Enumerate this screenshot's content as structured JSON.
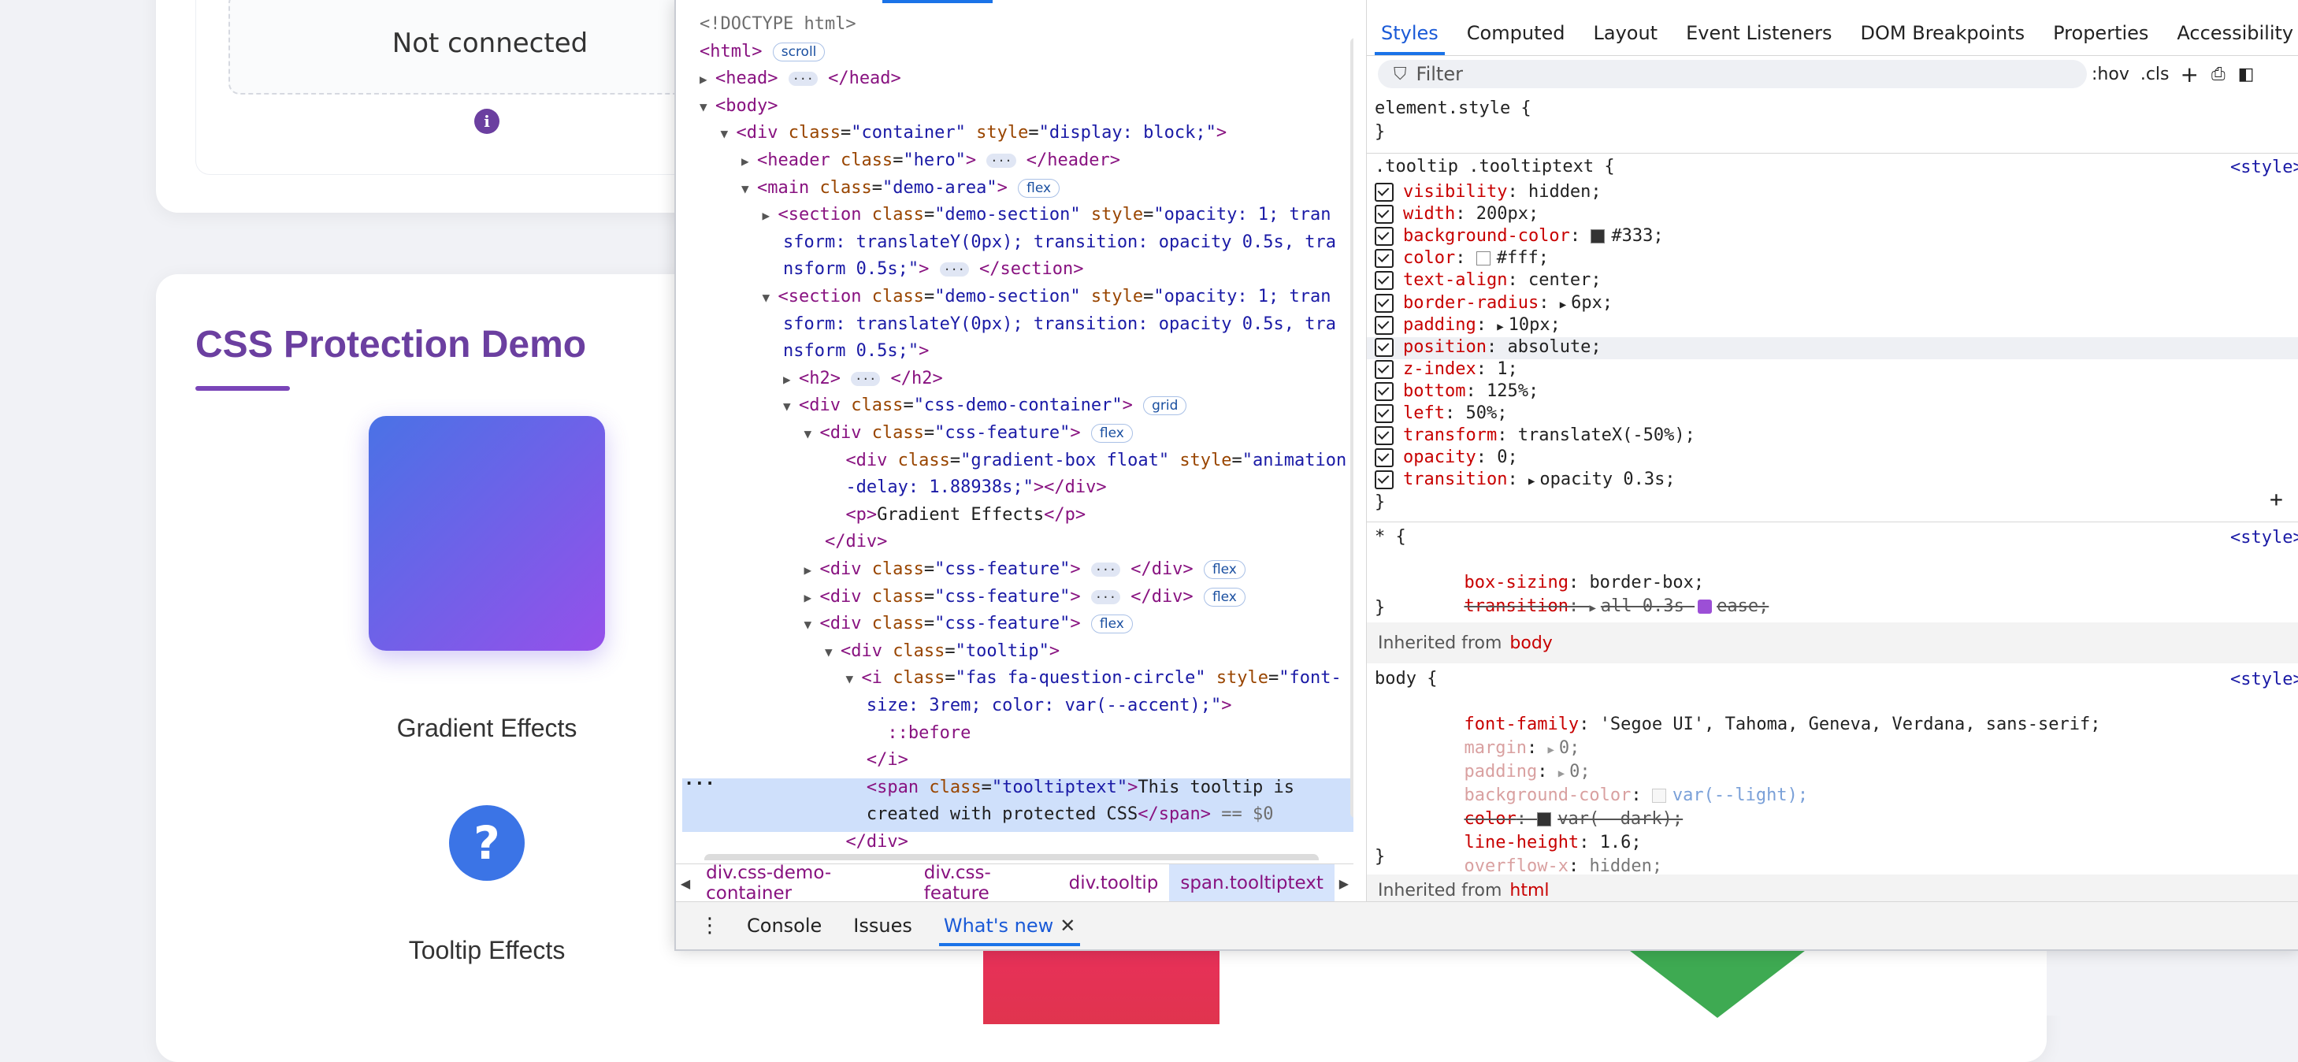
{
  "page": {
    "not_connected": "Not connected",
    "info_icon": "i",
    "demo_title": "CSS Protection Demo",
    "gradient_label": "Gradient Effects",
    "question_glyph": "?",
    "tooltip_label": "Tooltip Effects"
  },
  "devtools": {
    "elements": {
      "lines": [
        {
          "html": "<span class='cm'>&lt;!DOCTYPE html&gt;</span>"
        },
        {
          "html": "<span class='tag'>&lt;html&gt;</span> <span class='pill'>scroll</span>"
        },
        {
          "html": "<span class='tri'>▶</span><span class='tag'>&lt;head&gt;</span> <span class='dots'>···</span> <span class='tag'>&lt;/head&gt;</span>"
        },
        {
          "html": "<span class='tri'>▼</span><span class='tag'>&lt;body&gt;</span>"
        },
        {
          "html": "  <span class='tri'>▼</span><span class='tag'>&lt;div </span><span class='attr'>class</span>=<span class='val'>\"container\"</span> <span class='attr'>style</span>=<span class='val'>\"display: block;\"</span><span class='tag'>&gt;</span>"
        },
        {
          "html": "    <span class='tri'>▶</span><span class='tag'>&lt;header </span><span class='attr'>class</span>=<span class='val'>\"hero\"</span><span class='tag'>&gt;</span> <span class='dots'>···</span> <span class='tag'>&lt;/header&gt;</span>"
        },
        {
          "html": "    <span class='tri'>▼</span><span class='tag'>&lt;main </span><span class='attr'>class</span>=<span class='val'>\"demo-area\"</span><span class='tag'>&gt;</span> <span class='pill'>flex</span>"
        },
        {
          "html": "      <span class='tri'>▶</span><span class='tag'>&lt;section </span><span class='attr'>class</span>=<span class='val'>\"demo-section\"</span> <span class='attr'>style</span>=<span class='val'>\"opacity: 1; tran</span>"
        },
        {
          "html": "        <span class='val'>sform: translateY(0px); transition: opacity 0.5s, tra</span>"
        },
        {
          "html": "        <span class='val'>nsform 0.5s;\"</span><span class='tag'>&gt;</span> <span class='dots'>···</span> <span class='tag'>&lt;/section&gt;</span>"
        },
        {
          "html": "      <span class='tri'>▼</span><span class='tag'>&lt;section </span><span class='attr'>class</span>=<span class='val'>\"demo-section\"</span> <span class='attr'>style</span>=<span class='val'>\"opacity: 1; tran</span>"
        },
        {
          "html": "        <span class='val'>sform: translateY(0px); transition: opacity 0.5s, tra</span>"
        },
        {
          "html": "        <span class='val'>nsform 0.5s;\"</span><span class='tag'>&gt;</span>"
        },
        {
          "html": "        <span class='tri'>▶</span><span class='tag'>&lt;h2&gt;</span> <span class='dots'>···</span> <span class='tag'>&lt;/h2&gt;</span>"
        },
        {
          "html": "        <span class='tri'>▼</span><span class='tag'>&lt;div </span><span class='attr'>class</span>=<span class='val'>\"css-demo-container\"</span><span class='tag'>&gt;</span> <span class='pill'>grid</span>"
        },
        {
          "html": "          <span class='tri'>▼</span><span class='tag'>&lt;div </span><span class='attr'>class</span>=<span class='val'>\"css-feature\"</span><span class='tag'>&gt;</span> <span class='pill'>flex</span>"
        },
        {
          "html": "              <span class='tag'>&lt;div </span><span class='attr'>class</span>=<span class='val'>\"gradient-box float\"</span> <span class='attr'>style</span>=<span class='val'>\"animation</span>"
        },
        {
          "html": "              <span class='val'>-delay: 1.88938s;\"</span><span class='tag'>&gt;&lt;/div&gt;</span>"
        },
        {
          "html": "              <span class='tag'>&lt;p&gt;</span>Gradient Effects<span class='tag'>&lt;/p&gt;</span>"
        },
        {
          "html": "            <span class='tag'>&lt;/div&gt;</span>"
        },
        {
          "html": "          <span class='tri'>▶</span><span class='tag'>&lt;div </span><span class='attr'>class</span>=<span class='val'>\"css-feature\"</span><span class='tag'>&gt;</span> <span class='dots'>···</span> <span class='tag'>&lt;/div&gt;</span> <span class='pill'>flex</span>"
        },
        {
          "html": "          <span class='tri'>▶</span><span class='tag'>&lt;div </span><span class='attr'>class</span>=<span class='val'>\"css-feature\"</span><span class='tag'>&gt;</span> <span class='dots'>···</span> <span class='tag'>&lt;/div&gt;</span> <span class='pill'>flex</span>"
        },
        {
          "html": "          <span class='tri'>▼</span><span class='tag'>&lt;div </span><span class='attr'>class</span>=<span class='val'>\"css-feature\"</span><span class='tag'>&gt;</span> <span class='pill'>flex</span>"
        },
        {
          "html": "            <span class='tri'>▼</span><span class='tag'>&lt;div </span><span class='attr'>class</span>=<span class='val'>\"tooltip\"</span><span class='tag'>&gt;</span>"
        },
        {
          "html": "              <span class='tri'>▼</span><span class='tag'>&lt;i </span><span class='attr'>class</span>=<span class='val'>\"fas fa-question-circle\"</span> <span class='attr'>style</span>=<span class='val'>\"font-</span>"
        },
        {
          "html": "                <span class='val'>size: 3rem; color: var(--accent);\"</span><span class='tag'>&gt;</span>"
        },
        {
          "html": "                  <span class='tag'>::before</span>"
        },
        {
          "html": "                <span class='tag'>&lt;/i&gt;</span>"
        },
        {
          "html": "                <span class='tag'>&lt;span </span><span class='attr'>class</span>=<span class='val'>\"tooltiptext\"</span><span class='tag'>&gt;</span>This tooltip is"
        },
        {
          "html": "                created with protected CSS<span class='tag'>&lt;/span&gt;</span> <span class='cm'>== $0</span>"
        },
        {
          "html": "              <span class='tag'>&lt;/div&gt;</span>"
        }
      ]
    },
    "breadcrumbs": [
      "div.css-demo-container",
      "div.css-feature",
      "div.tooltip",
      "span.tooltiptext"
    ],
    "drawer_tabs": [
      "Console",
      "Issues",
      "What's new"
    ],
    "styles_tabs": [
      "Styles",
      "Computed",
      "Layout",
      "Event Listeners",
      "DOM Breakpoints",
      "Properties",
      "Accessibility"
    ],
    "filter_placeholder": "Filter",
    "filter_tools": [
      ":hov",
      ".cls",
      "+",
      "⎙",
      "◧"
    ],
    "rules": {
      "element_style": "element.style {",
      "close": "}",
      "tooltip_selector": ".tooltip .tooltiptext {",
      "tooltip_props": [
        [
          "visibility",
          "hidden;"
        ],
        [
          "width",
          "200px;"
        ],
        [
          "background-color",
          "#333;"
        ],
        [
          "color",
          "#fff;"
        ],
        [
          "text-align",
          "center;"
        ],
        [
          "border-radius",
          "6px;"
        ],
        [
          "padding",
          "10px;"
        ],
        [
          "position",
          "absolute;"
        ],
        [
          "z-index",
          "1;"
        ],
        [
          "bottom",
          "125%;"
        ],
        [
          "left",
          "50%;"
        ],
        [
          "transform",
          "translateX(-50%);"
        ],
        [
          "opacity",
          "0;"
        ],
        [
          "transition",
          "opacity 0.3s;"
        ]
      ],
      "universal_selector": "* {",
      "universal_props": [
        [
          "box-sizing",
          "border-box;"
        ],
        [
          "transition",
          "all 0.3s ease;"
        ]
      ],
      "inherited_body": "Inherited from",
      "inherited_body_tag": "body",
      "body_selector": "body {",
      "body_props": [
        [
          "font-family",
          "'Segoe UI', Tahoma, Geneva, Verdana, sans-serif;"
        ],
        [
          "margin",
          "0;"
        ],
        [
          "padding",
          "0;"
        ],
        [
          "background-color",
          "var(--light);"
        ],
        [
          "color",
          "var(--dark);"
        ],
        [
          "line-height",
          "1.6;"
        ],
        [
          "overflow-x",
          "hidden;"
        ]
      ],
      "inherited_html_tag": "html",
      "source": "<style>",
      "plus": "+"
    },
    "colors": {
      "accent_blue": "#1a73e8",
      "tag": "#881280",
      "attr": "#994500",
      "value": "#1a1aa6",
      "prop": "#c80000"
    }
  }
}
